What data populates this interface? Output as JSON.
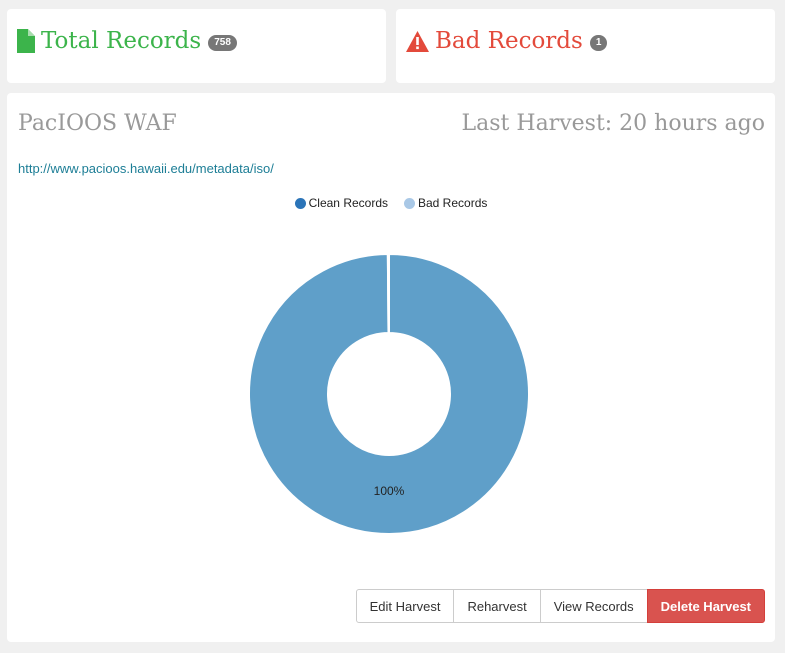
{
  "stats": {
    "total": {
      "label": "Total Records",
      "count": "758",
      "color": "#3cb44b",
      "icon": "file-icon"
    },
    "bad": {
      "label": "Bad Records",
      "count": "1",
      "color": "#e34a3b",
      "icon": "warning-icon"
    }
  },
  "harvest": {
    "name": "PacIOOS WAF",
    "last_harvest": "Last Harvest: 20 hours ago",
    "url": "http://www.pacioos.hawaii.edu/metadata/iso/"
  },
  "chart_data": {
    "type": "pie",
    "donut": true,
    "legend_position": "top-center",
    "series": [
      {
        "name": "Clean Records",
        "value": 757,
        "color": "#5f9fc9",
        "legend_color": "#2b74b8"
      },
      {
        "name": "Bad Records",
        "value": 1,
        "color": "#a9c8e6",
        "legend_color": "#a9c8e6"
      }
    ],
    "labels": [
      "100%"
    ]
  },
  "actions": {
    "edit": "Edit Harvest",
    "reharvest": "Reharvest",
    "view": "View Records",
    "delete": "Delete Harvest"
  }
}
